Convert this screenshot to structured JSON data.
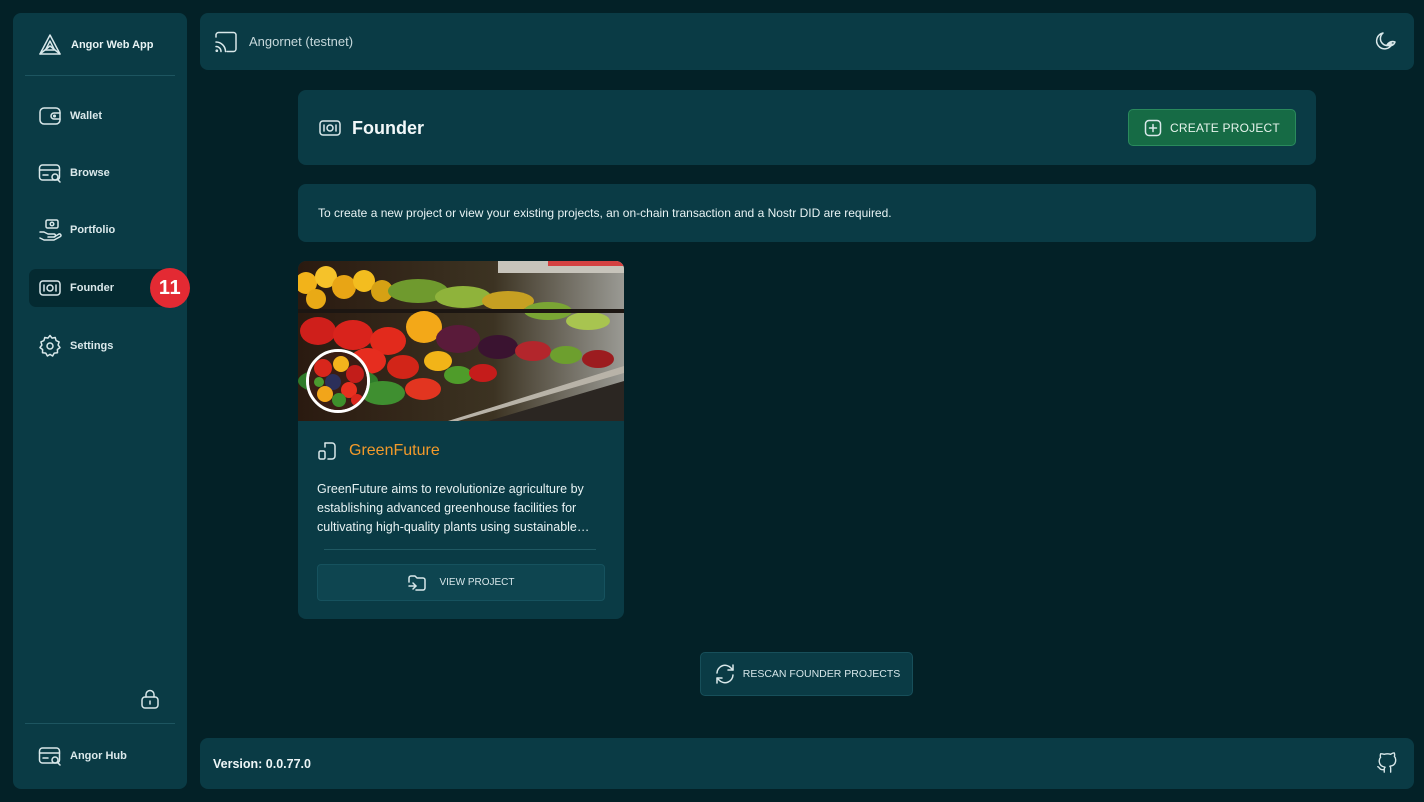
{
  "sidebar": {
    "brand": {
      "label": "Angor Web App",
      "icon": "angor-logo-icon"
    },
    "items": [
      {
        "label": "Wallet",
        "icon": "wallet-icon"
      },
      {
        "label": "Browse",
        "icon": "browse-icon"
      },
      {
        "label": "Portfolio",
        "icon": "portfolio-icon"
      },
      {
        "label": "Founder",
        "icon": "founder-icon",
        "active": true,
        "badge": "11"
      },
      {
        "label": "Settings",
        "icon": "gear-icon"
      }
    ],
    "lock_icon": "lock-icon",
    "hub": {
      "label": "Angor Hub",
      "icon": "hub-icon"
    }
  },
  "header": {
    "network_label": "Angornet (testnet)",
    "network_icon": "cast-icon",
    "theme_icon": "theme-toggle-icon"
  },
  "founder": {
    "title": "Founder",
    "create_button": "CREATE PROJECT",
    "info_text": "To create a new project or view your existing projects, an on-chain transaction and a Nostr DID are required."
  },
  "project": {
    "name": "GreenFuture",
    "description": "GreenFuture aims to revolutionize agriculture by establishing advanced greenhouse facilities for cultivating high-quality plants using sustainable methods and innovative technologies.",
    "view_button": "VIEW PROJECT"
  },
  "rescan_button": "RESCAN FOUNDER PROJECTS",
  "footer": {
    "version": "Version: 0.0.77.0",
    "github_icon": "github-icon"
  },
  "colors": {
    "background": "#032127",
    "panel": "#0a3b45",
    "accent_green": "#166b45",
    "project_name": "#f39a2a",
    "badge": "#e32a33"
  }
}
